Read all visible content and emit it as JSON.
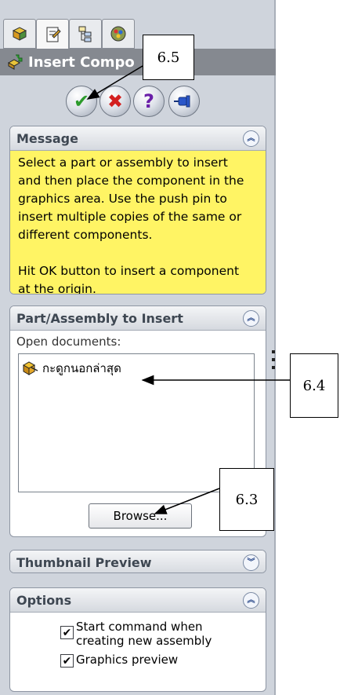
{
  "title": "Insert Compo",
  "tabs": [
    {
      "icon": "feature-manager-icon"
    },
    {
      "icon": "property-manager-icon"
    },
    {
      "icon": "configuration-manager-icon"
    },
    {
      "icon": "appearance-manager-icon"
    }
  ],
  "actions": {
    "ok_icon": "checkmark-icon",
    "cancel_icon": "x-icon",
    "help_icon": "help-icon",
    "pin_icon": "push-pin-icon",
    "ok_glyph": "✔",
    "cancel_glyph": "✖",
    "help_glyph": "?"
  },
  "message": {
    "heading": "Message",
    "lines": [
      "Select a part or assembly to insert",
      "and then place the component in the",
      "graphics area. Use the push pin to",
      "insert multiple copies of the same or",
      "different components.",
      "",
      "Hit OK button to insert a component",
      "at the origin."
    ]
  },
  "part_assembly": {
    "heading": "Part/Assembly to Insert",
    "open_documents_label": "Open documents:",
    "documents": [
      "กะดูกนอกล่าสุด"
    ],
    "browse_label": "Browse..."
  },
  "thumbnail": {
    "heading": "Thumbnail Preview"
  },
  "options": {
    "heading": "Options",
    "start_command_line1": "Start command when",
    "start_command_line2": "creating new assembly",
    "start_command_checked": true,
    "graphics_preview": "Graphics preview",
    "graphics_preview_checked": true
  },
  "callouts": {
    "c65": "6.5",
    "c64": "6.4",
    "c63": "6.3"
  },
  "colors": {
    "message_bg": "#fff464",
    "panel_bg": "#cfd4dc",
    "title_bg": "#858990"
  }
}
